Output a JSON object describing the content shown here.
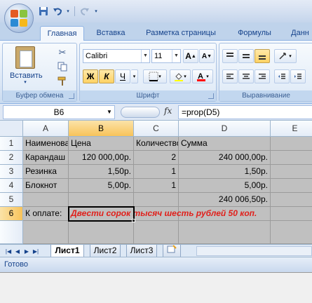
{
  "window": {
    "office_button_icon": "office-logo-icon"
  },
  "qat": {
    "save_icon": "save-icon",
    "undo_icon": "undo-icon",
    "redo_icon": "redo-icon"
  },
  "tabs": [
    {
      "label": "Главная"
    },
    {
      "label": "Вставка"
    },
    {
      "label": "Разметка страницы"
    },
    {
      "label": "Формулы"
    },
    {
      "label": "Данн"
    }
  ],
  "ribbon": {
    "clipboard": {
      "label": "Буфер обмена",
      "paste_label": "Вставить"
    },
    "font": {
      "label": "Шрифт",
      "font_name": "Calibri",
      "font_size": "11",
      "bold": "Ж",
      "italic": "К",
      "underline": "Ч",
      "grow": "A",
      "shrink": "A"
    },
    "alignment": {
      "label": "Выравнивание"
    }
  },
  "formula_bar": {
    "name_box": "B6",
    "fx": "fx",
    "formula": "=prop(D5)"
  },
  "columns": [
    "A",
    "B",
    "C",
    "D",
    "E"
  ],
  "rows": [
    "1",
    "2",
    "3",
    "4",
    "5",
    "6"
  ],
  "cells": {
    "A1": "Наименование",
    "B1": "Цена",
    "C1": "Количество",
    "D1": "Сумма",
    "A2": "Карандаш",
    "B2": "120 000,00р.",
    "C2": "2",
    "D2": "240 000,00р.",
    "A3": "Резинка",
    "B3": "1,50р.",
    "C3": "1",
    "D3": "1,50р.",
    "A4": "Блокнот",
    "B4": "5,00р.",
    "C4": "1",
    "D4": "5,00р.",
    "D5": "240 006,50р.",
    "A6": "К оплате:",
    "B6": "Двести сорок тысяч шесть рублей 50 коп."
  },
  "sheets": [
    {
      "label": "Лист1",
      "active": true
    },
    {
      "label": "Лист2",
      "active": false
    },
    {
      "label": "Лист3",
      "active": false
    }
  ],
  "status": {
    "text": "Готово"
  },
  "colors": {
    "red_text": "#e0201b",
    "selection_header": "#f8c35a",
    "accent": "#15428b"
  }
}
